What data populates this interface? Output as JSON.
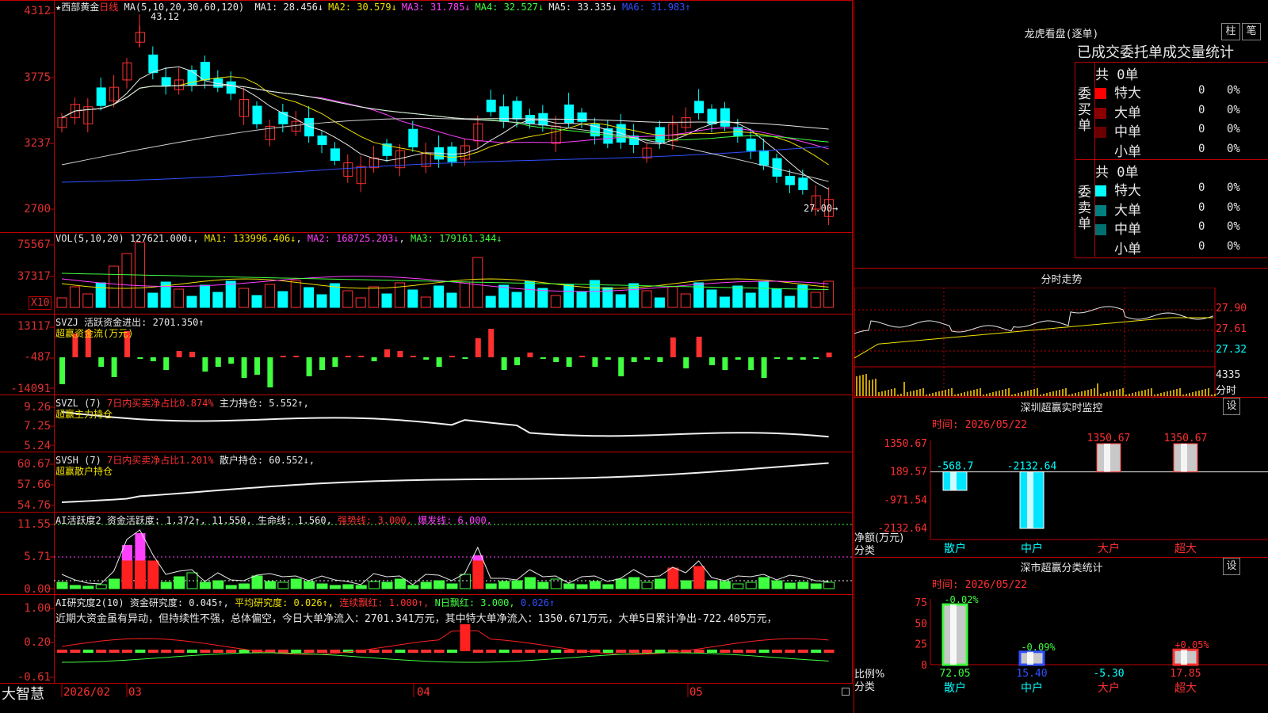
{
  "main_panel": {
    "title": "★西部黄金",
    "period": "日线",
    "ma_label": "MA(5,10,20,30,60,120)",
    "ma_values": [
      {
        "name": "MA1:",
        "value": "28.456↓",
        "color": "#e8e8e8"
      },
      {
        "name": "MA2:",
        "value": "30.579↓",
        "color": "#f0e000"
      },
      {
        "name": "MA3:",
        "value": "31.785↓",
        "color": "#ff40ff"
      },
      {
        "name": "MA4:",
        "value": "32.527↓",
        "color": "#40ff40"
      },
      {
        "name": "MA5:",
        "value": "33.335↓",
        "color": "#e8e8e8"
      },
      {
        "name": "MA6:",
        "value": "31.983↑",
        "color": "#3050ff"
      }
    ],
    "y_labels": [
      "4312",
      "3775",
      "3237",
      "2700"
    ],
    "high_label": "43.12",
    "low_label": "27.00→"
  },
  "vol_panel": {
    "label": "VOL(5,10,20)",
    "value": "127621.000↓",
    "ma1": "MA1: 133996.406↓",
    "ma2": "MA2: 168725.203↓",
    "ma3": "MA3: 179161.344↓",
    "y_labels": [
      "75567",
      "37317"
    ],
    "scale": "X10"
  },
  "svzj_panel": {
    "label": "SVZJ",
    "text": "活跃资金进出: 2701.350↑",
    "subtitle": "超赢资金流(万元)",
    "y_labels": [
      "13117",
      "-487",
      "-14091"
    ]
  },
  "svzl_panel": {
    "label": "SVZL (7)",
    "text1": "7日内买卖净占比0.874%",
    "text2": "主力持仓: 5.552↑,",
    "subtitle": "超赢主力持仓",
    "y_labels": [
      "9.26",
      "7.25",
      "5.24"
    ]
  },
  "svsh_panel": {
    "label": "SVSH (7)",
    "text1": "7日内买卖净占比1.201%",
    "text2": "散户持仓: 60.552↓,",
    "subtitle": "超赢散户持仓",
    "y_labels": [
      "60.67",
      "57.66",
      "54.76"
    ]
  },
  "ai_active_panel": {
    "label": "AI活跃度2",
    "t1": "资金活跃度: 1.372↑,",
    "t2": "11.550,",
    "t3": "生命线: 1.560,",
    "t4": "强势线: 3.000,",
    "t5": "爆发线: 6.000,",
    "y_labels": [
      "11.55",
      "5.71",
      "0.00"
    ]
  },
  "ai_research_panel": {
    "label": "AI研究度2(10)",
    "t1": "资金研究度: 0.045↑,",
    "t2": "平均研究度: 0.026↑,",
    "t3": "连续飘红: 1.000↑,",
    "t4": "N日飘红: 3.000,",
    "t5": "0.026↑",
    "commentary": "近期大资金虽有异动，但持续性不强，总体偏空，今日大单净流入：2701.341万元，其中特大单净流入：1350.671万元，大单5日累计净出-722.405万元，",
    "y_labels": [
      "1.00",
      "0.20",
      "-0.61"
    ]
  },
  "bottom_bar": {
    "brand": "大智慧",
    "dates": [
      "2026/02",
      "03",
      "04",
      "05"
    ]
  },
  "right_panel": {
    "lhb_title": "龙虎看盘(逐单)",
    "btn_bar": "柱",
    "btn_pen": "笔",
    "table_title": "已成交委托单成交量统计",
    "buy": {
      "header": "共 0单",
      "side_label": "委买单",
      "rows": [
        {
          "label": "特大",
          "count": "0",
          "pct": "0%",
          "color": "#ff0000"
        },
        {
          "label": "大单",
          "count": "0",
          "pct": "0%",
          "color": "#8b0000"
        },
        {
          "label": "中单",
          "count": "0",
          "pct": "0%",
          "color": "#6a0000"
        },
        {
          "label": "小单",
          "count": "0",
          "pct": "0%",
          "color": "#000000"
        }
      ]
    },
    "sell": {
      "header": "共 0单",
      "side_label": "委卖单",
      "rows": [
        {
          "label": "特大",
          "count": "0",
          "pct": "0%",
          "color": "#00ffff"
        },
        {
          "label": "大单",
          "count": "0",
          "pct": "0%",
          "color": "#008080"
        },
        {
          "label": "中单",
          "count": "0",
          "pct": "0%",
          "color": "#007070"
        },
        {
          "label": "小单",
          "count": "0",
          "pct": "0%",
          "color": "#000000"
        }
      ]
    },
    "intraday": {
      "title": "分时走势",
      "y_labels": [
        "27.90",
        "27.61",
        "27.32"
      ],
      "vol_label": "4335",
      "vol_unit": "分时"
    },
    "sz_monitor": {
      "title": "深圳超赢实时监控",
      "settings": "设",
      "time": "时间: 2026/05/22",
      "y_labels": [
        "1350.67",
        "189.57",
        "-971.54",
        "-2132.64"
      ],
      "y_caption1": "净额(万元)",
      "y_caption2": "分类",
      "categories": [
        "散户",
        "中户",
        "大户",
        "超大"
      ],
      "bar_labels": [
        "-568.7",
        "-2132.64",
        "1350.67",
        "1350.67"
      ]
    },
    "sz_class": {
      "title": "深市超赢分类统计",
      "settings": "设",
      "time": "时间: 2026/05/22",
      "y_labels": [
        "75",
        "50",
        "25",
        "0"
      ],
      "y_caption1": "比例%",
      "y_caption2": "分类",
      "categories": [
        "散户",
        "中户",
        "大户",
        "超大"
      ],
      "values": [
        "72.05",
        "15.40",
        "-5.30",
        "17.85"
      ],
      "pct_labels": [
        "-0.02%",
        "-0.09%",
        "",
        "+0.05%"
      ]
    }
  },
  "chart_data": {
    "type": "bar",
    "title": "深圳超赢实时监控",
    "categories": [
      "散户",
      "中户",
      "大户",
      "超大"
    ],
    "series": [
      {
        "name": "净额(万元)",
        "values": [
          -568.7,
          -2132.64,
          1350.67,
          1350.67
        ]
      }
    ],
    "ylim": [
      -2132.64,
      1350.67
    ]
  }
}
